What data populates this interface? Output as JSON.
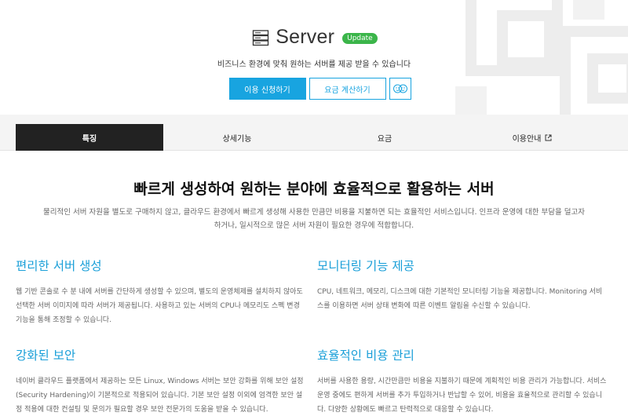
{
  "hero": {
    "title": "Server",
    "badge": "Update",
    "subtitle": "비즈니스 환경에 맞춰 원하는 서버를 제공 받을 수 있습니다",
    "primary_button": "이용 신청하기",
    "secondary_button": "요금 계산하기",
    "icon_button": "chat-face-icon"
  },
  "tabs": [
    {
      "label": "특징"
    },
    {
      "label": "상세기능"
    },
    {
      "label": "요금"
    },
    {
      "label": "이용안내"
    }
  ],
  "main": {
    "title": "빠르게 생성하여 원하는 분야에 효율적으로 활용하는 서버",
    "description": "물리적인 서버 자원을 별도로 구매하지 않고, 클라우드 환경에서 빠르게 생성해 사용한 만큼만 비용을 지불하면 되는 효율적인 서비스입니다. 인프라 운영에 대한 부담을 덜고자 하거나, 일시적으로 많은 서버 자원이 필요한 경우에 적합합니다."
  },
  "features": [
    {
      "title": "편리한 서버 생성",
      "text": "웹 기반 콘솔로 수 분 내에 서버를 간단하게 생성할 수 있으며, 별도의 운영체제를 설치하지 않아도 선택한 서버 이미지에 따라 서버가 제공됩니다. 사용하고 있는 서버의 CPU나 메모리도 스펙 변경 기능을 통해 조정할 수 있습니다."
    },
    {
      "title": "모니터링 기능 제공",
      "text": "CPU, 네트워크, 메모리, 디스크에 대한 기본적인 모니터링 기능을 제공합니다. Monitoring 서비스를 이용하면 서버 상태 변화에 따른 이벤트 알림을 수신할 수 있습니다."
    },
    {
      "title": "강화된 보안",
      "text": "네이버 클라우드 플랫폼에서 제공하는 모든 Linux, Windows 서버는 보안 강화를 위해 보안 설정(Security Hardening)이 기본적으로 적용되어 있습니다. 기본 보안 설정 이외에 엄격한 보안 설정 적용에 대한 컨설팅 및 문의가 필요할 경우 보안 전문가의 도움을 받을 수 있습니다."
    },
    {
      "title": "효율적인 비용 관리",
      "text": "서버를 사용한 용량, 시간만큼만 비용을 지불하기 때문에 계획적인 비용 관리가 가능합니다. 서비스 운영 중에도 편하게 서버를 추가 투입하거나 반납할 수 있어, 비용을 효율적으로 관리할 수 있습니다. 다양한 상황에도 빠르고 탄력적으로 대응할 수 있습니다."
    }
  ],
  "colors": {
    "accent": "#18a4e0",
    "badge": "#3bb54a",
    "active_tab": "#222222"
  }
}
